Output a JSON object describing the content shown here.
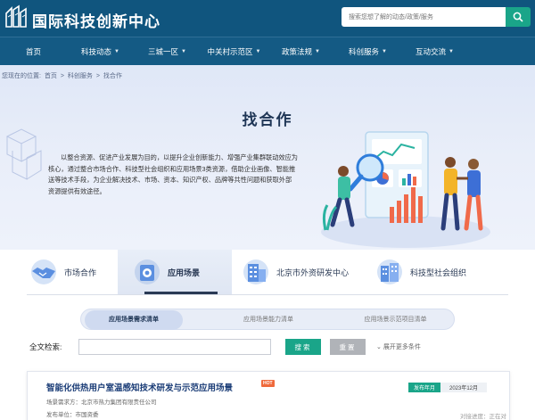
{
  "header": {
    "site_title": "国际科技创新中心",
    "search_placeholder": "搜索您想了解的动态/政策/服务",
    "search_icon": "search-icon"
  },
  "nav": {
    "items": [
      {
        "label": "首页",
        "caret": ""
      },
      {
        "label": "科技动态",
        "caret": "▼"
      },
      {
        "label": "三城一区",
        "caret": "▼"
      },
      {
        "label": "中关村示范区",
        "caret": "▼"
      },
      {
        "label": "政策法规",
        "caret": "▼"
      },
      {
        "label": "科创服务",
        "caret": "▼"
      },
      {
        "label": "互动交流",
        "caret": "▼"
      }
    ]
  },
  "breadcrumb": {
    "prefix": "您现在的位置:",
    "items": [
      "首页",
      "科创服务",
      "找合作"
    ],
    "separator": ">"
  },
  "banner": {
    "title": "找合作",
    "intro": "以整合资源、促进产业发展为目的，以提升企业创新能力、增强产业集群联动效应为核心，通过整合市场合作、科技型社会组织和应用场景3类资源，借助企业画像、智能推送等技术手段，为企业解决技术、市场、资本、知识产权、品牌等共性问题和获取外部资源提供有效途径。"
  },
  "categories": [
    {
      "label": "市场合作",
      "icon": "handshake-icon"
    },
    {
      "label": "应用场景",
      "icon": "scene-icon",
      "active": true
    },
    {
      "label": "北京市外资研发中心",
      "icon": "building-icon"
    },
    {
      "label": "科技型社会组织",
      "icon": "organization-icon"
    }
  ],
  "subtabs": [
    {
      "label": "应用场景需求清单",
      "active": true
    },
    {
      "label": "应用场景能力清单"
    },
    {
      "label": "应用场景示范项目清单"
    }
  ],
  "search_row": {
    "label": "全文检索:",
    "input_value": "",
    "search_button": "搜索",
    "reset_button": "重置",
    "more_label": "展开更多条件"
  },
  "result": {
    "title": "智能化供热用户室温感知技术研发与示范应用场景",
    "hot": "HOT",
    "publish_badge": "发布年月",
    "publish_date": "2023年12月",
    "requirer": "场景需求方：北京市热力集团有限责任公司",
    "publisher": "发布单位：市国资委",
    "dock_status": "对接进度：正在对接中"
  },
  "colors": {
    "header_bg": "#10557e",
    "accent_green": "#1aa589",
    "title_blue": "#1b3d77"
  }
}
